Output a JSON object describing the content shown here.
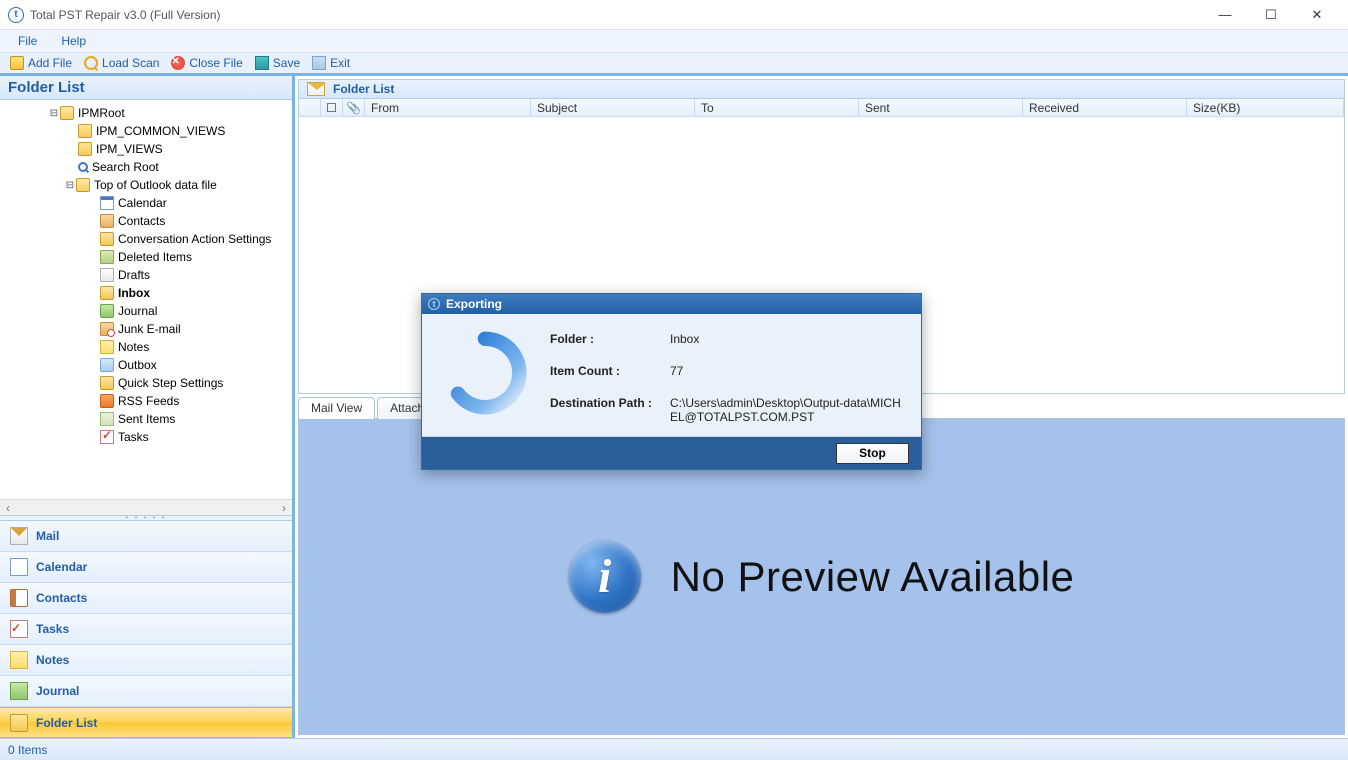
{
  "titlebar": {
    "title": "Total PST Repair v3.0 (Full Version)"
  },
  "menubar": {
    "file": "File",
    "help": "Help"
  },
  "toolbar": {
    "add_file": "Add File",
    "load_scan": "Load Scan",
    "close_file": "Close File",
    "save": "Save",
    "exit": "Exit"
  },
  "left_panel": {
    "header": "Folder List",
    "tree": {
      "root": "IPMRoot",
      "ipm_common_views": "IPM_COMMON_VIEWS",
      "ipm_views": "IPM_VIEWS",
      "search_root": "Search Root",
      "top_outlook": "Top of Outlook data file",
      "calendar": "Calendar",
      "contacts": "Contacts",
      "conversation_action": "Conversation Action Settings",
      "deleted_items": "Deleted Items",
      "drafts": "Drafts",
      "inbox": "Inbox",
      "journal": "Journal",
      "junk": "Junk E-mail",
      "notes": "Notes",
      "outbox": "Outbox",
      "quick_step": "Quick Step Settings",
      "rss": "RSS Feeds",
      "sent_items": "Sent Items",
      "tasks": "Tasks"
    },
    "nav": {
      "mail": "Mail",
      "calendar": "Calendar",
      "contacts": "Contacts",
      "tasks": "Tasks",
      "notes": "Notes",
      "journal": "Journal",
      "folder_list": "Folder List"
    }
  },
  "right_panel": {
    "header": "Folder List",
    "columns": {
      "from": "From",
      "subject": "Subject",
      "to": "To",
      "sent": "Sent",
      "received": "Received",
      "size": "Size(KB)"
    },
    "tabs": {
      "mail_view": "Mail View",
      "attachment": "Attachment"
    },
    "preview_message": "No Preview Available"
  },
  "statusbar": {
    "items": "0 Items"
  },
  "dialog": {
    "title": "Exporting",
    "folder_label": "Folder :",
    "folder_value": "Inbox",
    "count_label": "Item Count :",
    "count_value": "77",
    "path_label": "Destination Path :",
    "path_value": "C:\\Users\\admin\\Desktop\\Output-data\\MICHEL@TOTALPST.COM.PST",
    "stop": "Stop"
  }
}
